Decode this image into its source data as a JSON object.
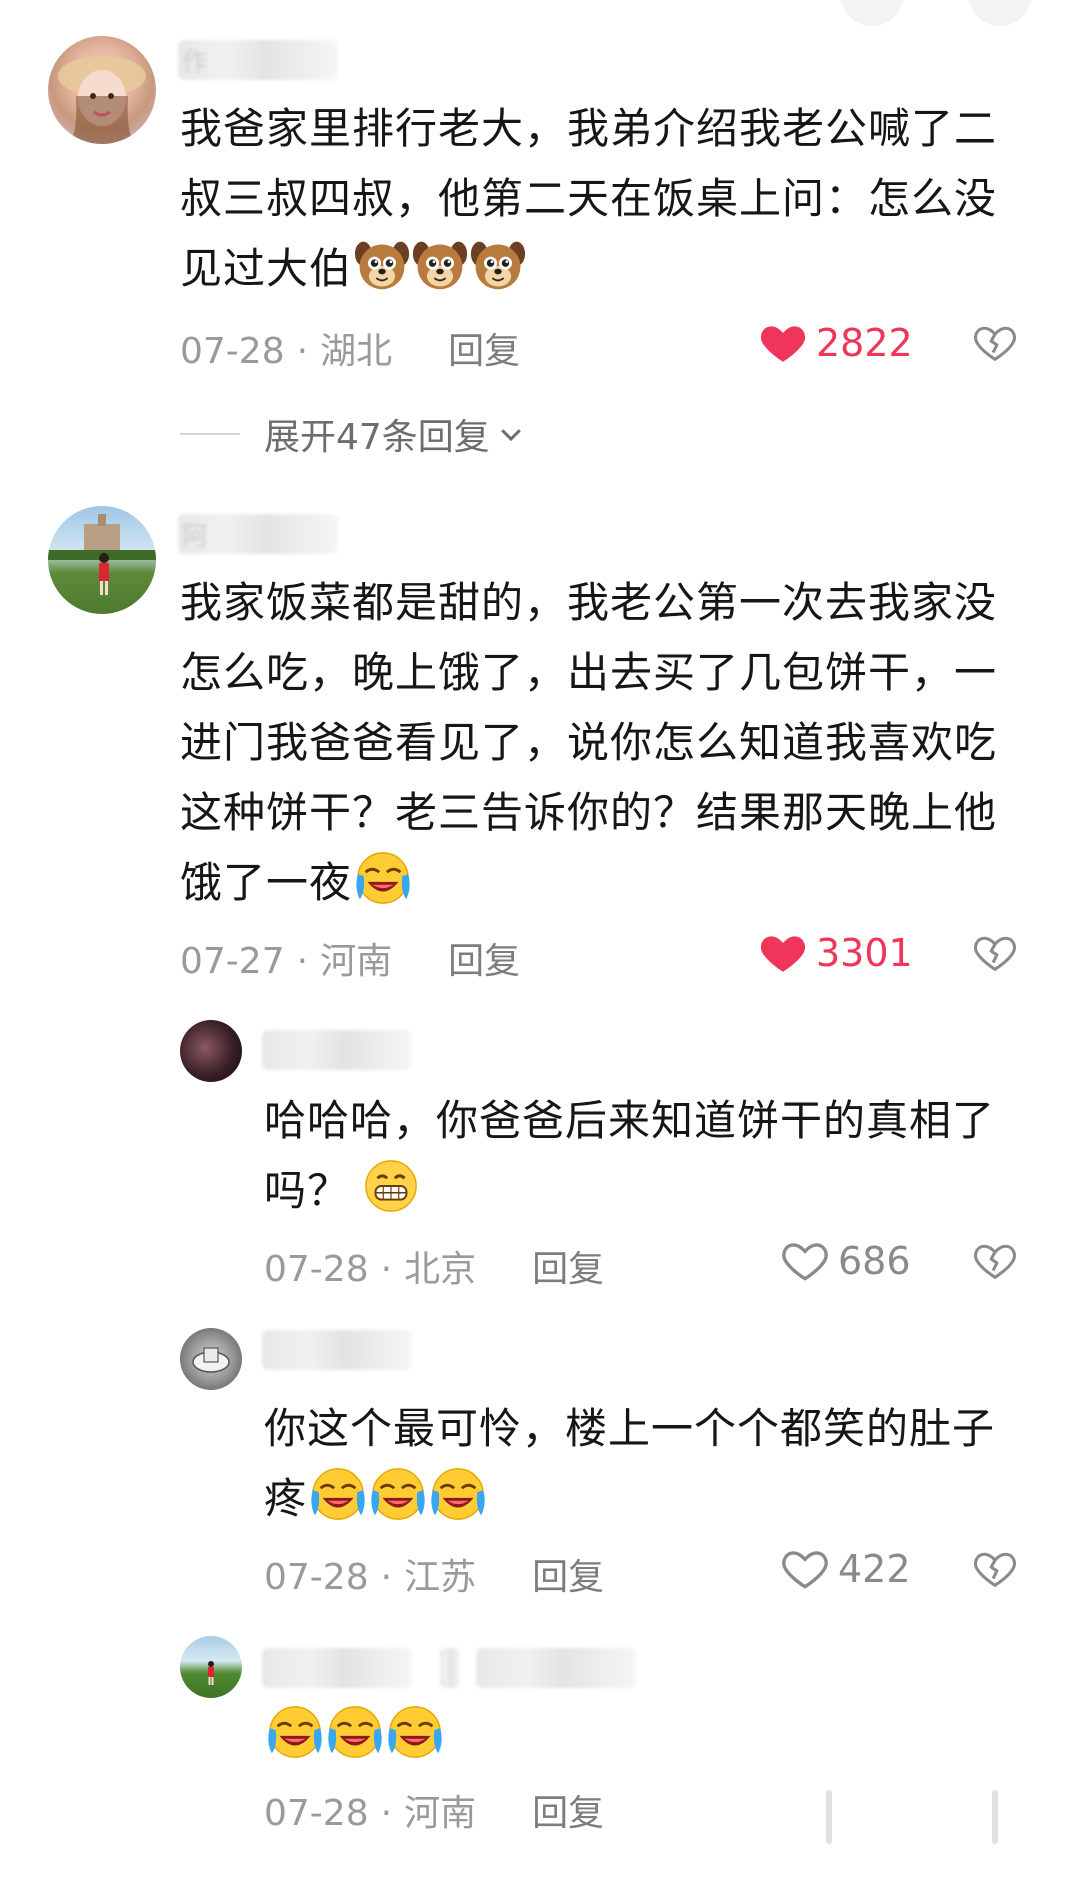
{
  "comments": [
    {
      "name_blurred": "作",
      "text": "我爸家里排行老大，我弟介绍我老公喊了二叔三叔四叔，他第二天在饭桌上问：怎么没见过大伯",
      "emoji": "dog-face-emoji",
      "date": "07-28",
      "location": "湖北",
      "reply_label": "回复",
      "likes": "2822",
      "liked": true,
      "expand_label": "展开47条回复"
    },
    {
      "name_blurred": "阿",
      "text": "我家饭菜都是甜的，我老公第一次去我家没怎么吃，晚上饿了，出去买了几包饼干，一进门我爸爸看见了，说你怎么知道我喜欢吃这种饼干？老三告诉你的？结果那天晚上他饿了一夜",
      "emoji": "crying-laughing-emoji",
      "date": "07-27",
      "location": "河南",
      "reply_label": "回复",
      "likes": "3301",
      "liked": true,
      "replies": [
        {
          "text": "哈哈哈，你爸爸后来知道饼干的真相了吗？",
          "emoji": "grinning-emoji",
          "date": "07-28",
          "location": "北京",
          "reply_label": "回复",
          "likes": "686",
          "liked": false
        },
        {
          "text": "你这个最可怜，楼上一个个都笑的肚子疼",
          "emoji": "crying-laughing-emoji",
          "date": "07-28",
          "location": "江苏",
          "reply_label": "回复",
          "likes": "422",
          "liked": false
        },
        {
          "text": "",
          "emoji": "crying-laughing-emoji",
          "date": "07-28",
          "location": "河南",
          "reply_label": "回复"
        }
      ]
    }
  ],
  "colors": {
    "like_active": "#f0355a",
    "meta_gray": "#9a9a9a",
    "text": "#161616"
  }
}
